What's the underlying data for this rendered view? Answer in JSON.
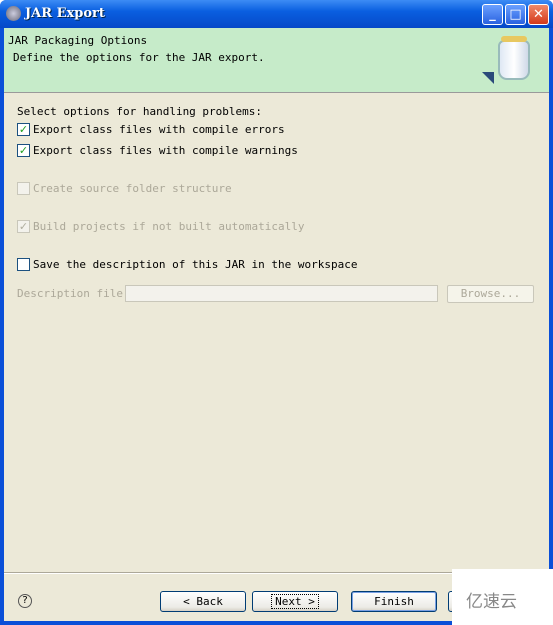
{
  "window": {
    "title": "JAR Export"
  },
  "banner": {
    "title": "JAR Packaging Options",
    "description": "Define the options for the JAR export."
  },
  "problems_label": "Select options for handling problems:",
  "options": [
    {
      "label": "Export class files with compile errors",
      "checked": true,
      "enabled": true
    },
    {
      "label": "Export class files with compile warnings",
      "checked": true,
      "enabled": true
    },
    {
      "label": "Create source folder structure",
      "checked": false,
      "enabled": false
    },
    {
      "label": "Build projects if not built automatically",
      "checked": true,
      "enabled": false
    },
    {
      "label": "Save the description of this JAR in the workspace",
      "checked": false,
      "enabled": true
    }
  ],
  "description_file": {
    "label": "Description file:",
    "value": "",
    "browse": "Browse..."
  },
  "buttons": {
    "back": "< Back",
    "next": "Next >",
    "finish": "Finish"
  },
  "watermark": "亿速云"
}
